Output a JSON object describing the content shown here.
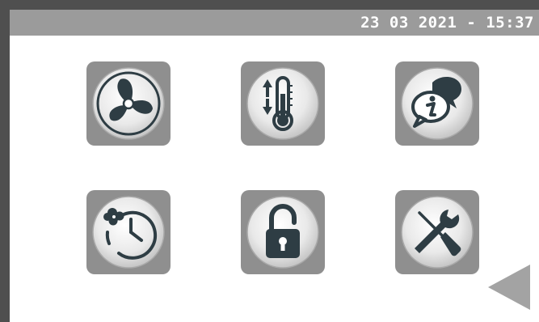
{
  "status_bar": {
    "datetime": "23 03 2021 - 15:37"
  },
  "menu": {
    "tiles": [
      {
        "icon": "fan-icon"
      },
      {
        "icon": "thermometer-icon"
      },
      {
        "icon": "info-chat-icon"
      },
      {
        "icon": "fan-clock-icon"
      },
      {
        "icon": "padlock-icon"
      },
      {
        "icon": "tools-icon"
      }
    ]
  },
  "navigation": {
    "back_icon": "back-triangle-icon"
  },
  "colors": {
    "frame": "#4f4f4f",
    "status_bar": "#9b9b9b",
    "tile": "#8f8f8f",
    "icon_dark": "#2e3d44",
    "back_arrow": "#a3a3a3"
  }
}
